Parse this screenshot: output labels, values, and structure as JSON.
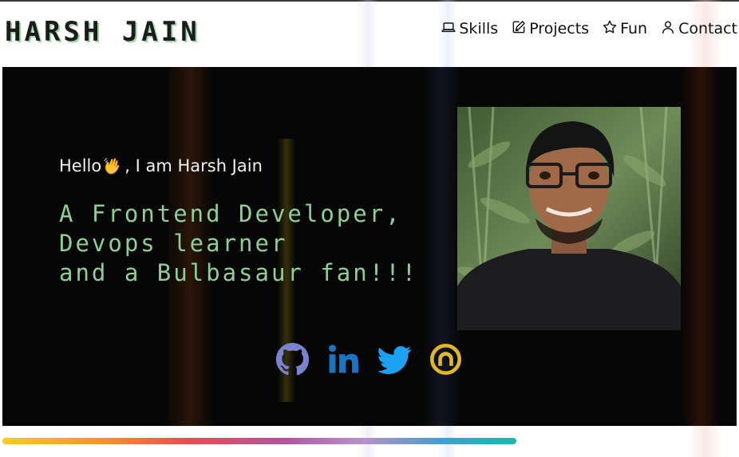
{
  "header": {
    "logo": "HARSH JAIN",
    "nav": [
      {
        "label": "Skills",
        "icon": "laptop-icon"
      },
      {
        "label": "Projects",
        "icon": "edit-icon"
      },
      {
        "label": "Fun",
        "icon": "star-icon"
      },
      {
        "label": "Contact",
        "icon": "user-icon"
      }
    ]
  },
  "hero": {
    "greeting_prefix": "Hello",
    "greeting_emoji": "waving-hand-icon",
    "greeting_suffix": ", I am Harsh Jain",
    "tagline": [
      "A Frontend Developer,",
      "Devops learner",
      "and a Bulbasaur fan!!!"
    ],
    "photo": "profile-photo",
    "socials": [
      {
        "name": "github",
        "icon": "github-icon",
        "color": "#7b82cf"
      },
      {
        "name": "linkedin",
        "icon": "linkedin-icon",
        "color": "#1b74c2"
      },
      {
        "name": "twitter",
        "icon": "twitter-icon",
        "color": "#1da1f2"
      },
      {
        "name": "hashnode",
        "icon": "hashnode-icon",
        "color": "#e0b727"
      }
    ]
  },
  "scroll_progress": 0.7,
  "colors": {
    "background": "#ffffff",
    "hero_background": "#060606",
    "tagline": "#8fcf93",
    "logo_shadow": "#9ed8a6"
  }
}
